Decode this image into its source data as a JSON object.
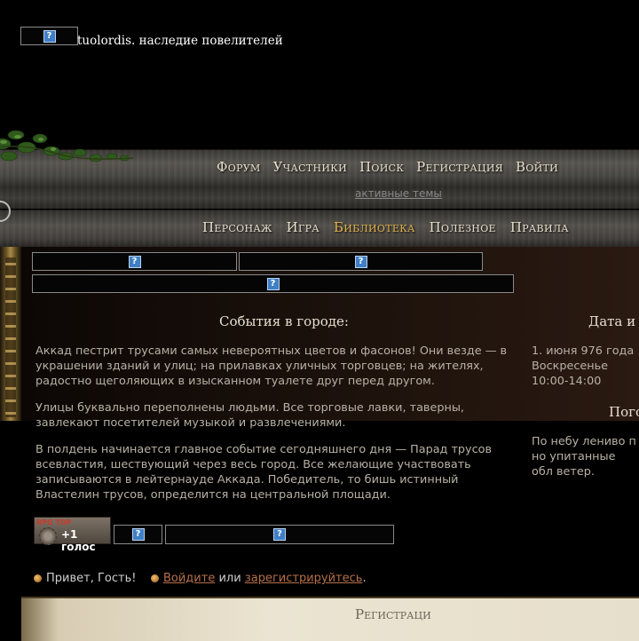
{
  "header": {
    "site_title": "tuolordis. наследие повелителей"
  },
  "nav_primary": [
    {
      "label": "Форум"
    },
    {
      "label": "Участники"
    },
    {
      "label": "Поиск"
    },
    {
      "label": "Регистрация"
    },
    {
      "label": "Войти"
    }
  ],
  "subnav": {
    "active_topics": "активные темы"
  },
  "nav_secondary": [
    {
      "label": "Персонаж",
      "active": false
    },
    {
      "label": "Игра",
      "active": false
    },
    {
      "label": "Библиотека",
      "active": true
    },
    {
      "label": "Полезное",
      "active": false
    },
    {
      "label": "Правила",
      "active": false
    }
  ],
  "events": {
    "title": "События в городе:",
    "paragraphs": [
      "Аккад пестрит трусами самых невероятных цветов и фасонов! Они везде — в украшении зданий и улиц; на прилавках уличных торговцев; на жителях, радостно щеголяющих в изысканном туалете друг перед другом.",
      "Улицы буквально переполнены людьми. Все торговые лавки, таверны, завлекают посетителей музыкой и развлечениями.",
      "В полдень начинается главное событие сегодняшнего дня — Парад трусов всевластия, шествующий через весь город. Все желающие участвовать записываются в лейтернауде Аккада. Победитель, то бишь истинный Властелин трусов, определится на центральной площади."
    ]
  },
  "date_panel": {
    "title": "Дата и",
    "date": "1. июня 976 года",
    "weekday": "Воскресенье",
    "time": "10:00-14:00"
  },
  "weather_panel": {
    "title": "Пого",
    "text": "По небу лениво п но упитанные обл ветер. Жарко, но"
  },
  "rating": {
    "top_label": "RPG TOP",
    "vote_label": "+1 голос"
  },
  "greeting": {
    "hello": "Привет, Гость!",
    "login_link": "Войдите",
    "or": "или",
    "register_link": "зарегистрируйтесь",
    "end": "."
  },
  "footer": {
    "panel_title": "Регистраци"
  },
  "colors": {
    "active_nav": "#e3b34b",
    "link": "#b8704a",
    "parchment": "#ebe4d2"
  }
}
